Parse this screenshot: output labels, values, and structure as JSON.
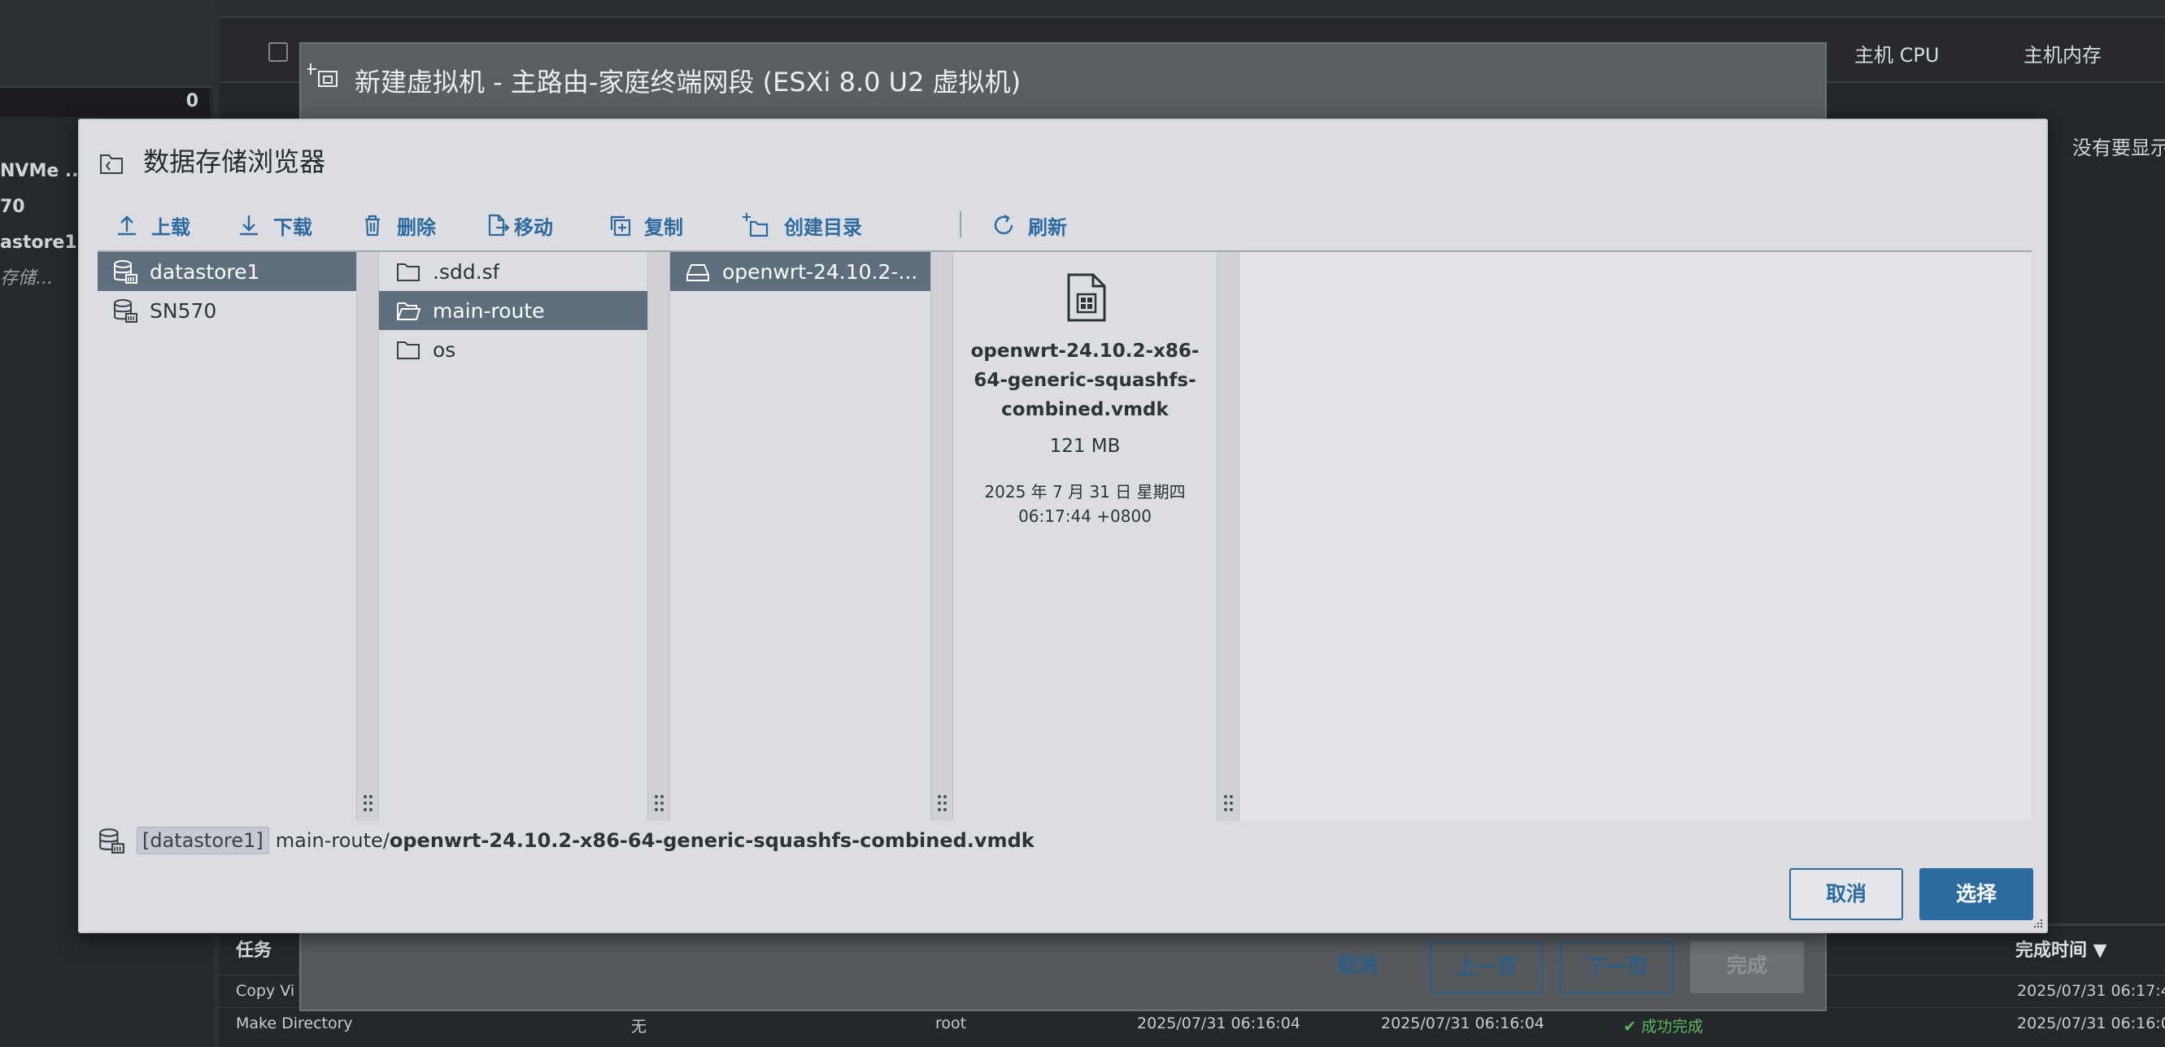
{
  "background": {
    "left_count": "0",
    "left_items": [
      "NVMe ...",
      "70",
      "astore1",
      "存储..."
    ],
    "header_cols": {
      "cpu": "主机 CPU",
      "memory": "主机内存"
    },
    "empty_text": "没有要显示",
    "tasks": {
      "header_task": "任务",
      "header_done": "完成时间 ▼",
      "rows": [
        {
          "task": "Copy Vi",
          "done": "2025/07/31 06:17:4"
        },
        {
          "task": "Make Directory",
          "target": "无",
          "user": "root",
          "queued": "2025/07/31 06:16:04",
          "started": "2025/07/31 06:16:04",
          "result": "成功完成",
          "done": "2025/07/31 06:16:0"
        }
      ]
    }
  },
  "wizard": {
    "title": "新建虚拟机 - 主路由-家庭终端网段 (ESXi 8.0 U2 虚拟机)",
    "buttons": {
      "cancel": "取消",
      "prev": "上一页",
      "next": "下一页",
      "finish": "完成"
    }
  },
  "dialog": {
    "title": "数据存储浏览器",
    "toolbar": {
      "upload": "上载",
      "download": "下载",
      "delete": "删除",
      "move": "移动",
      "copy": "复制",
      "mkdir": "创建目录",
      "refresh": "刷新"
    },
    "datastores": [
      {
        "name": "datastore1",
        "selected": true
      },
      {
        "name": "SN570",
        "selected": false
      }
    ],
    "folders": [
      {
        "name": ".sdd.sf",
        "selected": false
      },
      {
        "name": "main-route",
        "selected": true
      },
      {
        "name": "os",
        "selected": false
      }
    ],
    "files": [
      {
        "name": "openwrt-24.10.2-...",
        "selected": true
      }
    ],
    "detail": {
      "name": "openwrt-24.10.2-x86-64-generic-squashfs-combined.vmdk",
      "size": "121 MB",
      "date_line1": "2025 年 7 月 31 日 星期四",
      "date_line2": "06:17:44 +0800"
    },
    "path": {
      "datastore": "[datastore1]",
      "prefix": "main-route/",
      "file": "openwrt-24.10.2-x86-64-generic-squashfs-combined.vmdk"
    },
    "buttons": {
      "cancel": "取消",
      "select": "选择"
    },
    "colors": {
      "accent": "#2c6aa0",
      "selected_row": "#5f6e7c",
      "dialog_bg": "#dcdde3"
    }
  }
}
